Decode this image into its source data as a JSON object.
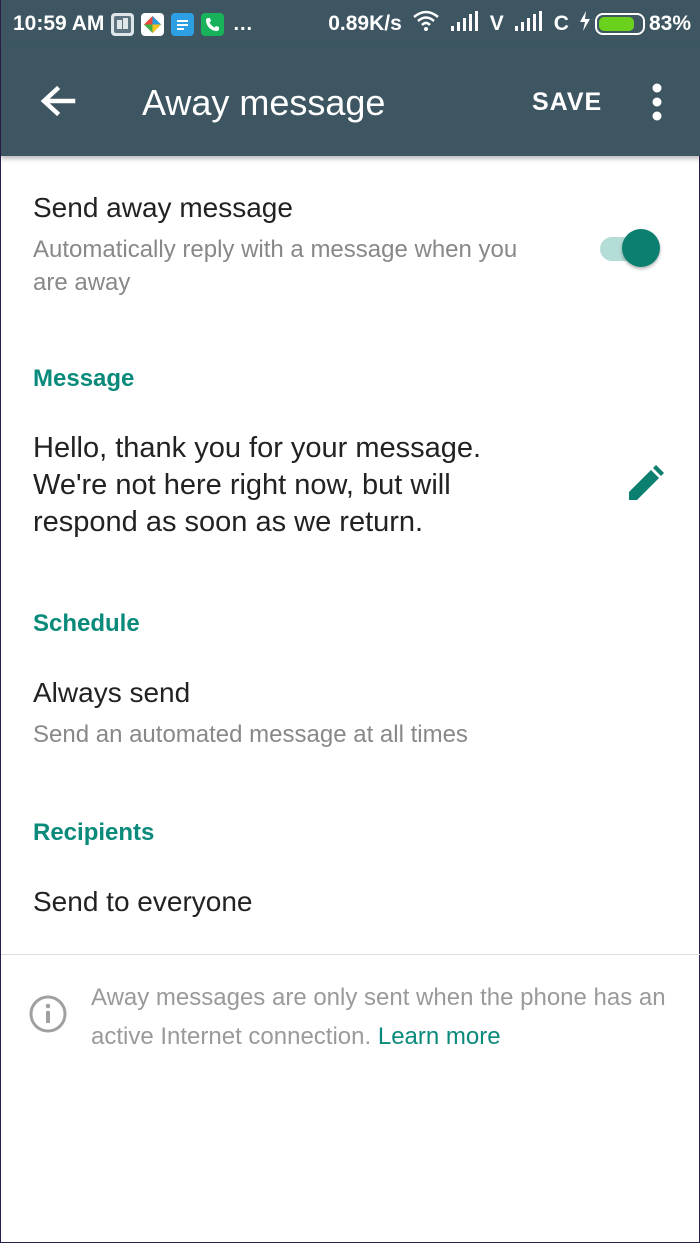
{
  "status_bar": {
    "time": "10:59 AM",
    "dots": "...",
    "speed": "0.89K/s",
    "carrier1": "V",
    "carrier2": "C",
    "battery": "83%",
    "battery_level": 0.83
  },
  "app_bar": {
    "title": "Away message",
    "save_label": "SAVE"
  },
  "send_away": {
    "title": "Send away message",
    "subtitle": "Automatically reply with a message when you are away",
    "enabled": true
  },
  "message_section": {
    "header": "Message",
    "text": "Hello, thank you for your message. We're not here right now, but will respond as soon as we return."
  },
  "schedule_section": {
    "header": "Schedule",
    "title": "Always send",
    "subtitle": "Send an automated message at all times"
  },
  "recipients_section": {
    "header": "Recipients",
    "title": "Send to everyone"
  },
  "footer": {
    "info_text": "Away messages are only sent when the phone has an active Internet connection.",
    "learn_more": "Learn more"
  },
  "colors": {
    "app_bar": "#3d5662",
    "accent": "#0a8a7a",
    "toggle_knob": "#0b7f70",
    "toggle_track": "#b5ddd8"
  }
}
